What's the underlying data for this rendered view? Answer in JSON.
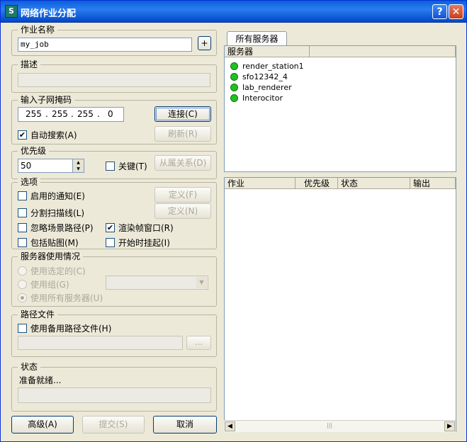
{
  "window": {
    "title": "网络作业分配",
    "help": "?",
    "close": "✕"
  },
  "job_name": {
    "legend": "作业名称",
    "value": "my_job",
    "plus": "+"
  },
  "description": {
    "legend": "描述",
    "value": ""
  },
  "subnet": {
    "legend": "输入子网掩码",
    "octets": [
      "255",
      "255",
      "255",
      "0"
    ],
    "connect": "连接(C)",
    "auto_search": "自动搜索(A)",
    "auto_search_checked": true,
    "refresh": "刷新(R)"
  },
  "priority": {
    "legend": "优先级",
    "value": "50",
    "critical": "关键(T)",
    "dependencies": "从属关系(D)"
  },
  "options": {
    "legend": "选项",
    "notify": "启用的通知(E)",
    "define1": "定义(F)",
    "split_scan": "分割扫描线(L)",
    "define2": "定义(N)",
    "ignore_paths": "忽略场景路径(P)",
    "render_window": "渲染帧窗口(R)",
    "render_window_checked": true,
    "include_maps": "包括贴图(M)",
    "start_suspended": "开始时挂起(I)"
  },
  "server_usage": {
    "legend": "服务器使用情况",
    "use_selected": "使用选定的(C)",
    "use_group": "使用组(G)",
    "use_all": "使用所有服务器(U)"
  },
  "path_file": {
    "legend": "路径文件",
    "use_alt": "使用备用路径文件(H)",
    "browse": "..."
  },
  "status": {
    "legend": "状态",
    "text": "准备就绪..."
  },
  "buttons": {
    "advanced": "高级(A)",
    "submit": "提交(S)",
    "cancel": "取消"
  },
  "servers": {
    "tab": "所有服务器",
    "header": "服务器",
    "items": [
      "render_station1",
      "sfo12342_4",
      "lab_renderer",
      "Interocitor"
    ],
    "status_color": "#22c022"
  },
  "jobs": {
    "headers": [
      "作业",
      "优先级",
      "状态",
      "输出"
    ],
    "scroll_left": "◀",
    "scroll_right": "▶",
    "scroll_grip": "|||"
  }
}
